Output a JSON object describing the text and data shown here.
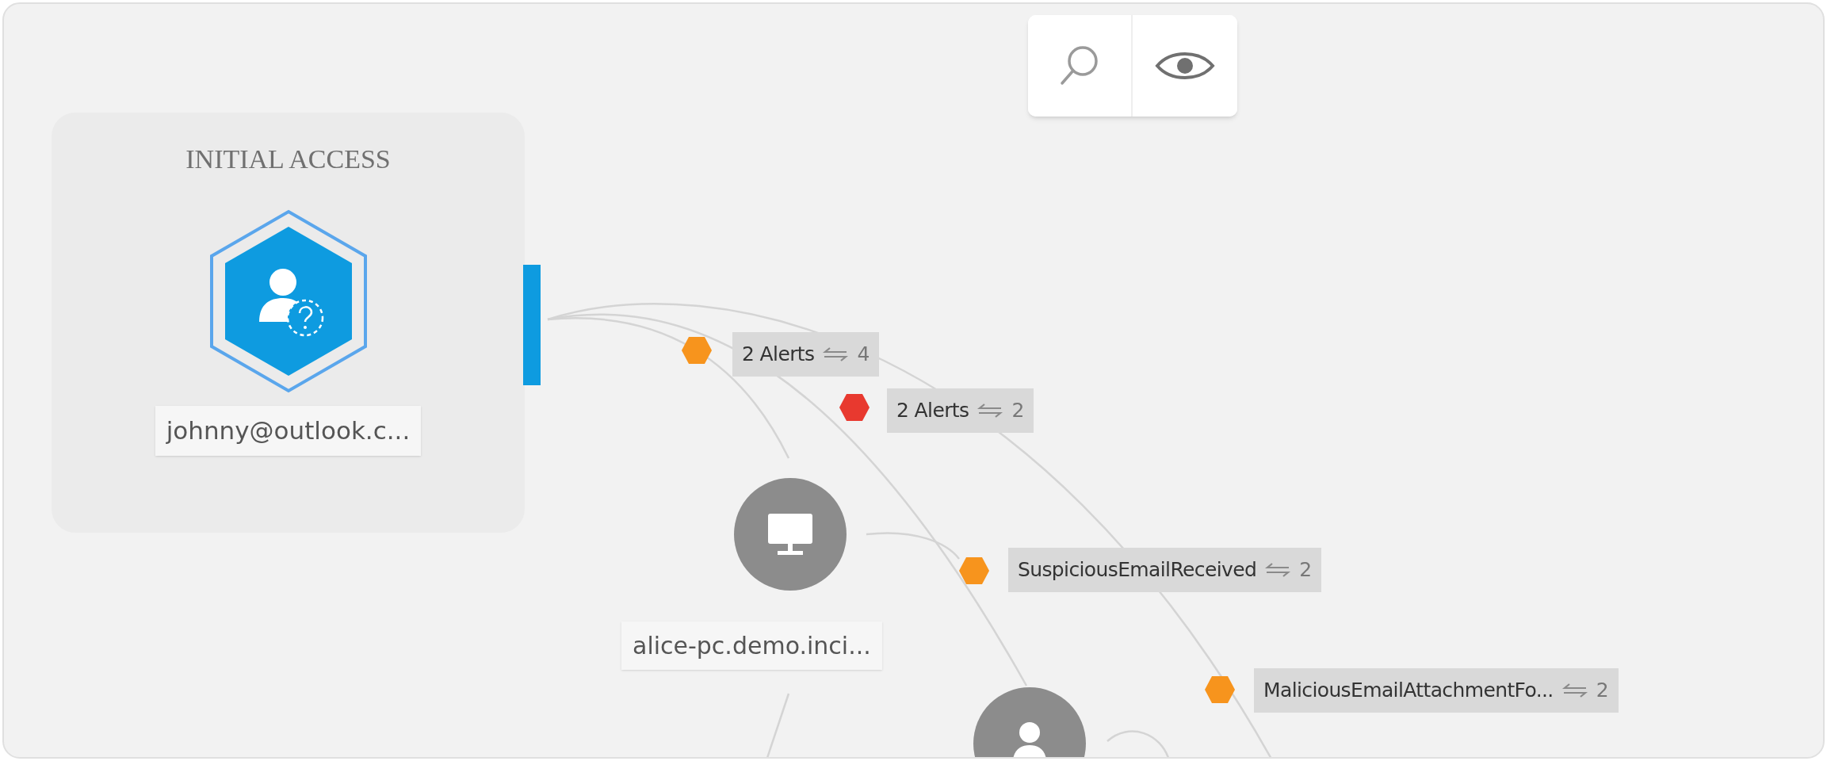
{
  "toolbar": [
    {
      "kind": "search"
    },
    {
      "kind": "view"
    }
  ],
  "phase": {
    "title": "INITIAL ACCESS",
    "node": {
      "kind": "unknown_user",
      "label": "johnny@outlook.c..."
    }
  },
  "nodes": [
    {
      "kind": "host",
      "label": "alice-pc.demo.inci..."
    },
    {
      "kind": "user"
    }
  ],
  "alerts": [
    {
      "label": "2 Alerts",
      "count": "4",
      "color": "#f7941d"
    },
    {
      "label": "2 Alerts",
      "count": "2",
      "color": "#e8392f"
    },
    {
      "label": "SuspiciousEmailReceived",
      "count": "2",
      "color": "#f7941d"
    },
    {
      "label": "MaliciousEmailAttachmentFo...",
      "count": "2",
      "color": "#f7941d"
    }
  ]
}
